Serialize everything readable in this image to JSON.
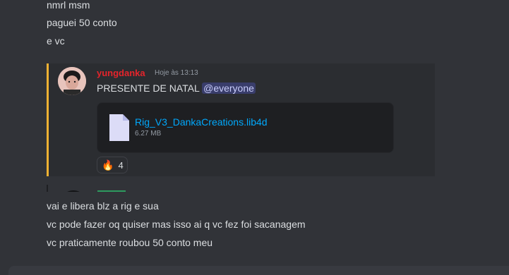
{
  "messages_top": [
    "nmrl msm",
    "paguei 50 conto",
    "e vc"
  ],
  "quoted_message": {
    "username": "yungdanka",
    "timestamp": "Hoje às 13:13",
    "text": "PRESENTE DE NATAL",
    "mention": "@everyone",
    "attachment": {
      "icon": "file-icon",
      "file_name": "Rig_V3_DankaCreations.lib4d",
      "file_size": "6.27 MB"
    },
    "reaction": {
      "emoji": "🔥",
      "count": "4"
    },
    "accent_color": "#f0b232",
    "username_color": "#e5242b"
  },
  "messages_bottom": [
    "vai e libera blz a rig e sua",
    "vc pode fazer oq quiser mas isso ai q vc fez foi sacanagem",
    "vc praticamente roubou 50 conto meu"
  ],
  "colors": {
    "background": "#313338",
    "embed_background": "#2b2d31",
    "link": "#00a8fc",
    "text": "#dbdee1"
  }
}
